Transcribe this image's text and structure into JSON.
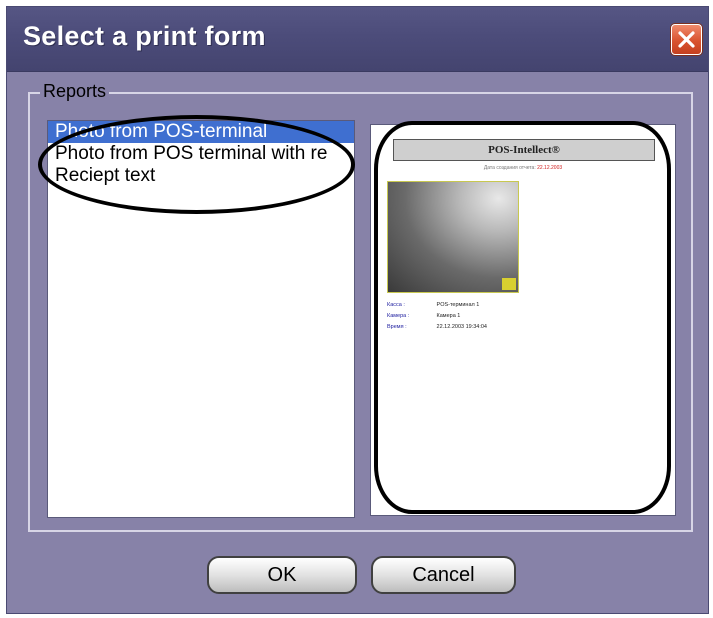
{
  "dialog": {
    "title": "Select a print form",
    "close_icon": "close-icon",
    "accent_color": "#d9532f"
  },
  "reports": {
    "group_label": "Reports",
    "items": [
      {
        "label": "Photo from POS-terminal",
        "selected": true
      },
      {
        "label": "Photo from POS terminal with re",
        "selected": false
      },
      {
        "label": "Reciept text",
        "selected": false
      }
    ],
    "selection_color": "#3f6fd0"
  },
  "preview": {
    "header": "POS-Intellect®",
    "date_label": "Дата создания отчета:",
    "date_value": "22.12.2003",
    "fields": [
      {
        "key": "Касса :",
        "value": "POS-терминал 1"
      },
      {
        "key": "Камера :",
        "value": "Камера 1"
      },
      {
        "key": "Время :",
        "value": "22.12.2003 19:34:04"
      }
    ]
  },
  "buttons": {
    "ok": "OK",
    "cancel": "Cancel"
  }
}
